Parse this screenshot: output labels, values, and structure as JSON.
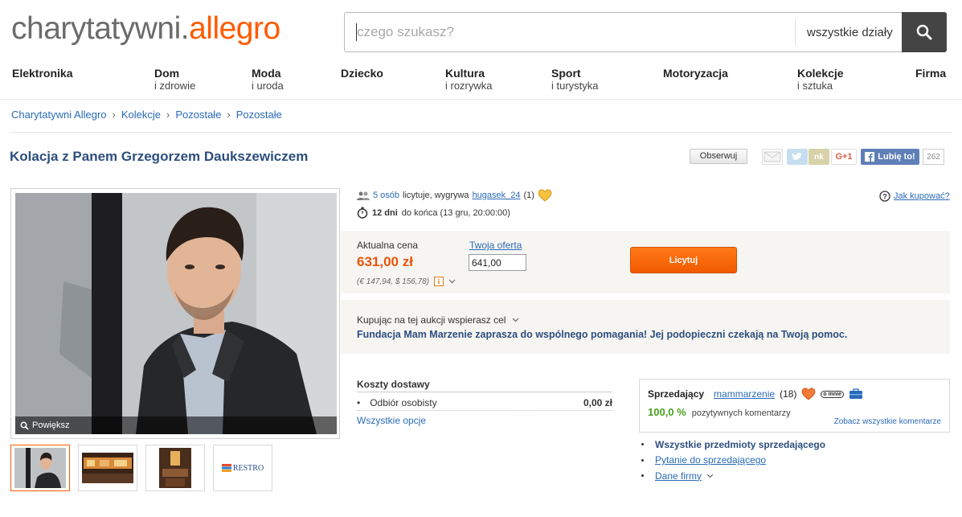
{
  "header": {
    "logo_part1": "charytatywni.",
    "logo_part2": "allegro",
    "search_placeholder": "czego szukasz?",
    "department": "wszystkie działy"
  },
  "categories": [
    {
      "main": "Elektronika",
      "sub": ""
    },
    {
      "main": "Dom",
      "sub": "i zdrowie"
    },
    {
      "main": "Moda",
      "sub": "i uroda"
    },
    {
      "main": "Dziecko",
      "sub": ""
    },
    {
      "main": "Kultura",
      "sub": "i rozrywka"
    },
    {
      "main": "Sport",
      "sub": "i turystyka"
    },
    {
      "main": "Motoryzacja",
      "sub": ""
    },
    {
      "main": "Kolekcje",
      "sub": "i sztuka"
    },
    {
      "main": "Firma",
      "sub": ""
    }
  ],
  "breadcrumb": [
    "Charytatywni Allegro",
    "Kolekcje",
    "Pozostałe",
    "Pozostałe"
  ],
  "breadcrumb_sep": "›",
  "item": {
    "title": "Kolacja z Panem Grzegorzem Daukszewiczem",
    "observe": "Obserwuj",
    "gplus": "G+1",
    "like": "Lubię to!",
    "like_count": "262",
    "zoom": "Powiększ"
  },
  "auction": {
    "bidders_link": "5 osób",
    "bidders_text": "licytuje, wygrywa",
    "winner": "hugasek_24",
    "winner_score": "(1)",
    "days": "12 dni",
    "end_text": "do końca (13 gru, 20:00:00)",
    "how_to_buy": "Jak kupować?",
    "price_label": "Aktualna cena",
    "price": "631,00 zł",
    "conversion": "(€ 147,94, $ 156,78)",
    "offer_label": "Twoja oferta",
    "offer_value": "641,00",
    "bid_button": "Licytuj",
    "cause_label": "Kupując na tej aukcji wspierasz cel",
    "cause_text": "Fundacja Mam Marzenie zaprasza do wspólnego pomagania! Jej podopieczni czekają na Twoją pomoc."
  },
  "shipping": {
    "heading": "Koszty dostawy",
    "method": "Odbiór osobisty",
    "cost": "0,00 zł",
    "all_options": "Wszystkie opcje"
  },
  "seller": {
    "label": "Sprzedający",
    "name": "mammarzenie",
    "score": "(18)",
    "badge": "o mnie",
    "percent": "100,0 %",
    "percent_text": "pozytywnych komentarzy",
    "all_comments": "Zobacz wszystkie komentarze",
    "links": [
      "Wszystkie przedmioty sprzedającego",
      "Pytanie do sprzedającego",
      "Dane firmy"
    ]
  },
  "thumbnails": [
    "RESTRO"
  ],
  "colors": {
    "brand_orange": "#ff5a00",
    "link_blue": "#2a6bb8",
    "title_navy": "#2d4e7e",
    "positive_green": "#4aa020"
  }
}
